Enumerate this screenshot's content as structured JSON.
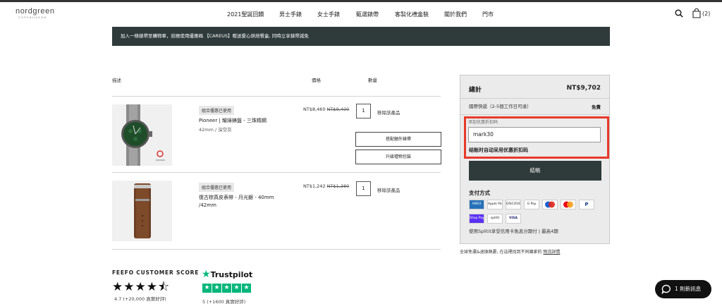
{
  "brand": {
    "name": "nordgreen",
    "tagline": "COPENHAGEN"
  },
  "nav": [
    "2021聖誕回饋",
    "男士手錶",
    "女士手錶",
    "甄選錶帶",
    "客製化禮盒裝",
    "關於我們",
    "門市"
  ],
  "header": {
    "bag_count": "(2)"
  },
  "banner": "加入一條錶帶至購物車，結帳使用優惠碼 【CAREUS】贈送愛心烘焙餐盒, 同時立享錶帶減免",
  "cart": {
    "columns": {
      "desc": "描述",
      "price": "價格",
      "qty": "數量"
    },
    "items": [
      {
        "badge": "組合優惠已使用",
        "name": "Pioneer | 耀綠錶盤 - 三珠精鋼",
        "sub": "42mm / 深空灰",
        "price": "NT$8,460",
        "old_price": "NT$9,400",
        "qty": "1",
        "remove": "移除該產品",
        "extra_buttons": [
          "搭配額外錶帶",
          "升級禮物包裝"
        ]
      },
      {
        "badge": "組合優惠已使用",
        "name_line1": "復古棕真皮表帶 - 月光銀 - 40mm",
        "name_line2": "/42mm",
        "price": "NT$1,242",
        "old_price": "NT$1,380",
        "qty": "1",
        "remove": "移除該產品"
      }
    ]
  },
  "summary": {
    "title": "總計",
    "total": "NT$9,702",
    "shipping_label": "國際快遞（2-5個工作日可達）",
    "shipping_value": "免費",
    "coupon_label": "添加优惠折扣码",
    "coupon_value": "mark30",
    "coupon_note": "结账时自动采用优惠折扣码",
    "checkout": "結帳",
    "payment_title": "支付方式",
    "payment_methods": [
      "AMEX",
      "Apple Pay",
      "DISCOVER",
      "G Pay",
      "Maestro",
      "Mastercard",
      "PayPal",
      "Shop Pay",
      "splitit",
      "VISA"
    ],
    "splitit_note": "使用Splitit享受信用卡免息分期付 | 最高4期"
  },
  "global_note": {
    "text": "全球免運&退換無憂, 在這裡找到不同國家的",
    "link": "物流詳情"
  },
  "feefo": {
    "title": "FEEFO CUSTOMER SCORE",
    "stars": "★★★★⯪",
    "score": "4.7 (+20,000 真實好評)"
  },
  "trustpilot": {
    "name": "Trustpilot",
    "score": "5 (+1600 真實好評)"
  },
  "chat": {
    "label": "1 則新訊息"
  },
  "colors": {
    "dark": "#2f3a3a",
    "highlight": "#e8392a",
    "trustpilot": "#00b67a"
  }
}
